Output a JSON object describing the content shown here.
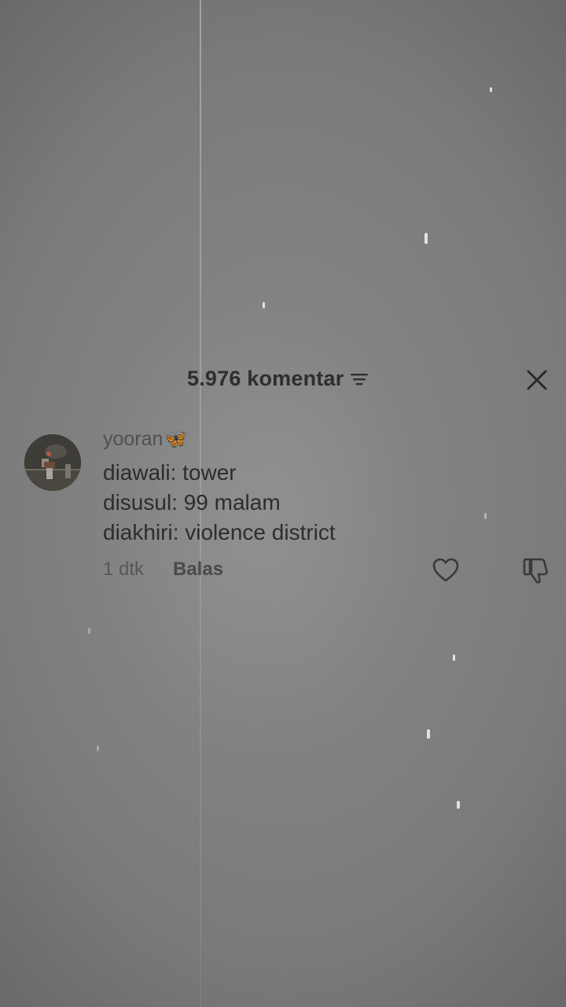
{
  "header": {
    "title": "5.976 komentar",
    "filter_icon": "sort-lines-icon",
    "close_icon": "close-icon"
  },
  "comment": {
    "username": "yooran🦋",
    "lines": [
      "diawali: tower",
      "disusul: 99 malam",
      "diakhiri: violence district"
    ],
    "time": "1 dtk",
    "reply_label": "Balas",
    "like_icon": "heart-outline-icon",
    "dislike_icon": "thumbs-down-icon"
  },
  "colors": {
    "text_dark": "#2d2d2d",
    "text_muted": "#565656",
    "background": "#7b7b7b"
  }
}
